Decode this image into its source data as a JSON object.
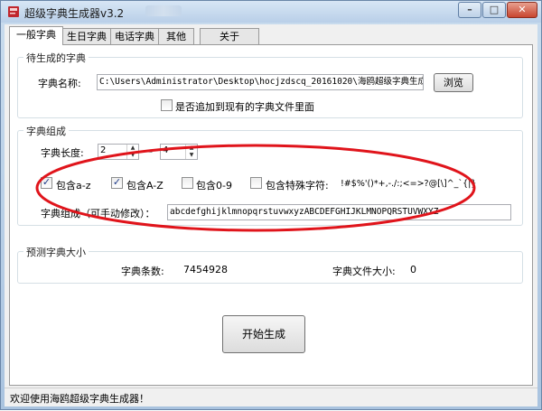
{
  "window": {
    "title": "超级字典生成器v3.2",
    "icon": "red-book-icon",
    "close_glyph": "✕",
    "minimize_glyph": "–",
    "maximize_glyph": "□"
  },
  "tabs": [
    {
      "label": "一般字典",
      "active": true
    },
    {
      "label": "生日字典"
    },
    {
      "label": "电话字典"
    },
    {
      "label": "其他"
    },
    {
      "label": "关于"
    }
  ],
  "pending": {
    "group_title": "待生成的字典",
    "name_label": "字典名称:",
    "path_value": "C:\\Users\\Administrator\\Desktop\\hocjzdscq_20161020\\海鸥超级字典生成",
    "browse_label": "浏览",
    "append_label": "是否追加到现有的字典文件里面",
    "append_checked": false
  },
  "composition": {
    "group_title": "字典组成",
    "length_label": "字典长度:",
    "length_min": "2",
    "dash": "—",
    "length_max": "4",
    "include_lower_label": "包含a-z",
    "include_lower_checked": true,
    "include_upper_label": "包含A-Z",
    "include_upper_checked": true,
    "include_digits_label": "包含0-9",
    "include_digits_checked": false,
    "include_special_label": "包含特殊字符:",
    "special_chars": "!#$%'()*+,-./:;<=>?@[\\]^_`{|}",
    "include_special_checked": false,
    "chars_label": "字典组成（可手动修改）：",
    "chars_value": "abcdefghijklmnopqrstuvwxyzABCDEFGHIJKLMNOPQRSTUVWXYZ"
  },
  "estimate": {
    "group_title": "预测字典大小",
    "count_label": "字典条数:",
    "count_value": "7454928",
    "size_label": "字典文件大小:",
    "size_value": "0"
  },
  "start_label": "开始生成",
  "status_text": "欢迎使用海鸥超级字典生成器！",
  "check_glyph": "✓",
  "colors": {
    "annotation_red": "#e0141b",
    "close_red": "#c8452f"
  }
}
